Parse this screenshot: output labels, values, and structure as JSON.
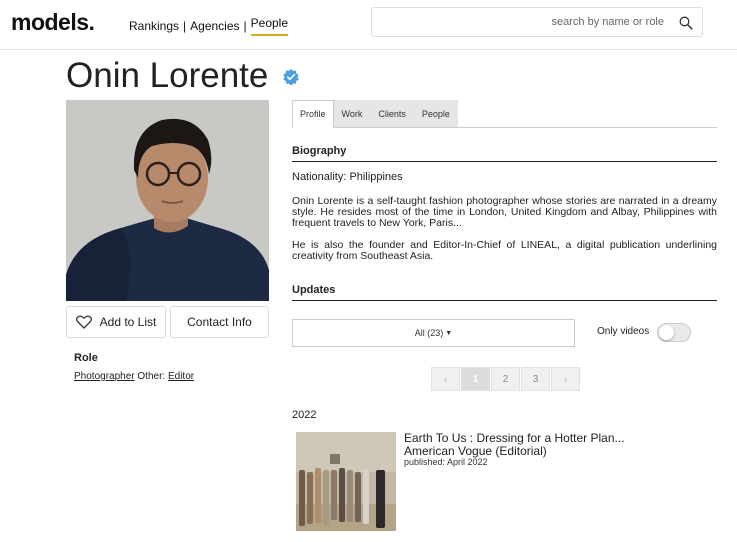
{
  "header": {
    "logo": "models.",
    "nav": {
      "rankings": "Rankings",
      "agencies": "Agencies",
      "people": "People",
      "separator": "|"
    },
    "search": {
      "placeholder": "search by name or role",
      "icon": "search-icon"
    }
  },
  "profile": {
    "name": "Onin Lorente",
    "verified_icon": "verified-badge-icon",
    "buttons": {
      "add_to_list": "Add to List",
      "contact_info": "Contact Info"
    },
    "role": {
      "title": "Role",
      "primary": "Photographer",
      "other_label": "Other:",
      "other": "Editor"
    }
  },
  "tabs": [
    "Profile",
    "Work",
    "Clients",
    "People"
  ],
  "biography": {
    "heading": "Biography",
    "nationality": "Nationality: Philippines",
    "paragraph1": "Onin Lorente is a self-taught fashion photographer whose stories are narrated in a dreamy style. He resides most of the time in London, United Kingdom and Albay, Philippines with frequent travels to New York, Paris...",
    "paragraph2": "He is also the founder and Editor-In-Chief of LINEAL, a digital publication underlining creativity from Southeast Asia."
  },
  "updates": {
    "heading": "Updates",
    "filter": "All (23)",
    "only_videos": "Only videos",
    "only_videos_on": false,
    "pagination": {
      "prev": "‹",
      "pages": [
        "1",
        "2",
        "3"
      ],
      "current": "1",
      "next": "›"
    },
    "year": "2022",
    "items": [
      {
        "title": "Earth To Us : Dressing for a Hotter Plan...",
        "subtitle": "American Vogue (Editorial)",
        "date": "published: April 2022"
      }
    ]
  },
  "colors": {
    "accent": "#d9a923",
    "verified": "#4a9fe3"
  }
}
